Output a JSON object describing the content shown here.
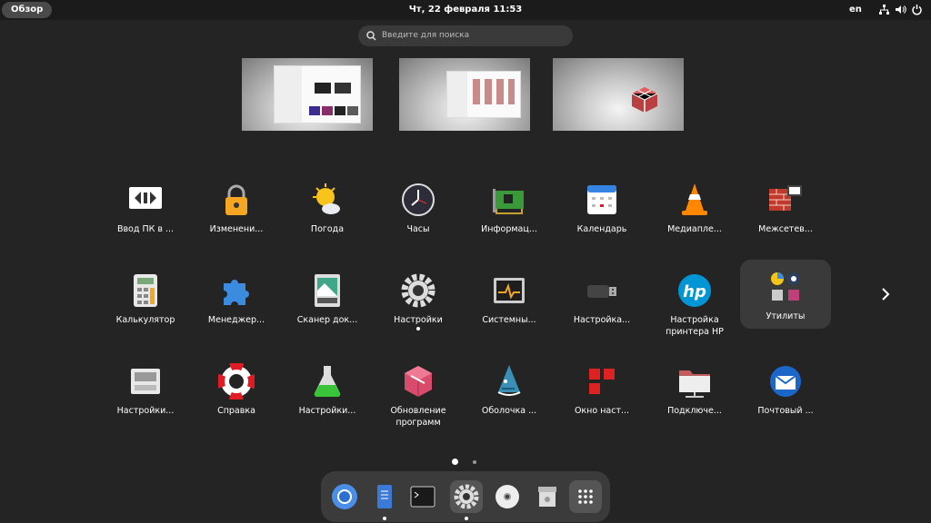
{
  "topbar": {
    "activities_label": "Обзор",
    "clock": "Чт, 22 февраля  11:53",
    "language": "en",
    "tray_icons": [
      "network-icon",
      "volume-icon",
      "power-icon"
    ]
  },
  "search": {
    "placeholder": "Введите для поиска"
  },
  "workspaces": [
    "workspace-1",
    "workspace-2",
    "workspace-3"
  ],
  "apps": [
    {
      "label": "Ввод ПК в ...",
      "icon": "remote-desktop-icon"
    },
    {
      "label": "Изменени...",
      "icon": "padlock-icon"
    },
    {
      "label": "Погода",
      "icon": "weather-icon"
    },
    {
      "label": "Часы",
      "icon": "clock-icon"
    },
    {
      "label": "Информац...",
      "icon": "hardware-info-icon"
    },
    {
      "label": "Календарь",
      "icon": "calendar-icon"
    },
    {
      "label": "Медиапле...",
      "icon": "vlc-cone-icon"
    },
    {
      "label": "Межсетев...",
      "icon": "firewall-icon"
    },
    {
      "label": "Калькулятор",
      "icon": "calculator-icon"
    },
    {
      "label": "Менеджер...",
      "icon": "puzzle-icon"
    },
    {
      "label": "Сканер док...",
      "icon": "scanner-icon"
    },
    {
      "label": "Настройки",
      "icon": "settings-gear-icon"
    },
    {
      "label": "Системны...",
      "icon": "system-monitor-icon"
    },
    {
      "label": "Настройка...",
      "icon": "usb-drive-icon"
    },
    {
      "label": "Настройка принтера HP",
      "icon": "hp-logo-icon"
    },
    {
      "label": "Утилиты",
      "icon": "folder-utilities-icon"
    },
    {
      "label": "Настройки...",
      "icon": "printer-settings-icon"
    },
    {
      "label": "Справка",
      "icon": "lifebuoy-icon"
    },
    {
      "label": "Настройки...",
      "icon": "flask-icon"
    },
    {
      "label": "Обновление программ",
      "icon": "package-icon"
    },
    {
      "label": "Оболочка ...",
      "icon": "shell-shark-icon"
    },
    {
      "label": "Окно наст...",
      "icon": "red-squares-icon"
    },
    {
      "label": "Подключе...",
      "icon": "network-folder-icon"
    },
    {
      "label": "Почтовый ...",
      "icon": "thunderbird-icon"
    }
  ],
  "dock": [
    "chromium-icon",
    "text-editor-icon",
    "terminal-icon",
    "settings-gear-icon",
    "optical-disc-icon",
    "archive-trash-icon",
    "app-grid-icon"
  ],
  "colors": {
    "background": "#242424",
    "topbar": "#1b1b1b",
    "dock": "#3b3b3b",
    "accent_red": "#c0392b"
  }
}
